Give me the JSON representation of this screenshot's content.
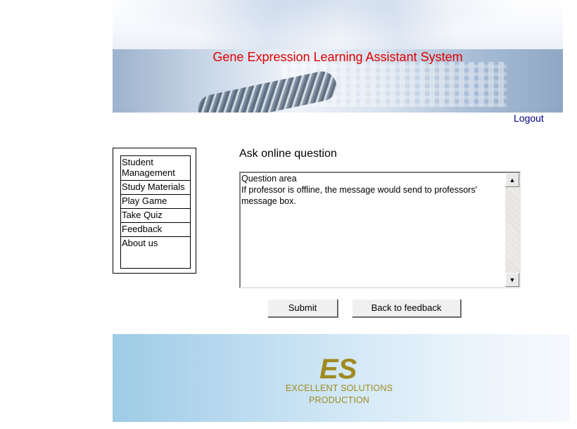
{
  "header": {
    "title": "Gene Expression Learning Assistant System",
    "logout_label": "Logout"
  },
  "sidebar": {
    "items": [
      {
        "label": "Student Management"
      },
      {
        "label": "Study Materials"
      },
      {
        "label": "Play Game"
      },
      {
        "label": "Take Quiz"
      },
      {
        "label": "Feedback"
      },
      {
        "label": "About us"
      }
    ]
  },
  "main": {
    "heading": "Ask online question",
    "question_text": "Question area\nIf professor is offline, the message would send to professors' message box.",
    "submit_label": "Submit",
    "back_label": "Back to feedback"
  },
  "footer": {
    "logo_text": "ES",
    "line1": "EXCELLENT SOLUTIONS",
    "line2": "PRODUCTION",
    "brand_color": "#a08a1e"
  },
  "colors": {
    "title": "#e00000",
    "link": "#000080"
  }
}
